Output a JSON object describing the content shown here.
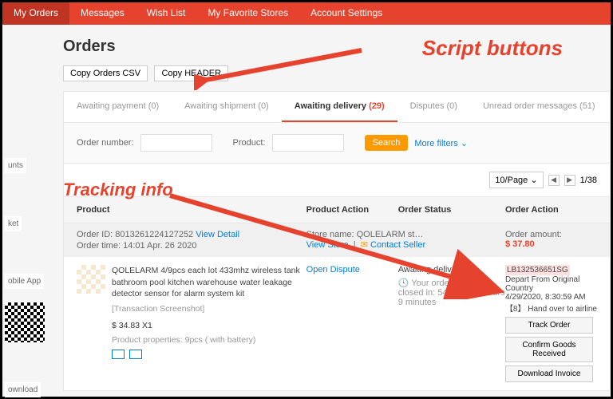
{
  "nav": {
    "items": [
      "My Orders",
      "Messages",
      "Wish List",
      "My Favorite Stores",
      "Account Settings"
    ],
    "active": 0
  },
  "page": {
    "title": "Orders"
  },
  "script_buttons": [
    "Copy Orders CSV",
    "Copy HEADER"
  ],
  "tabs": [
    {
      "label": "Awaiting payment",
      "count": "(0)"
    },
    {
      "label": "Awaiting shipment",
      "count": "(0)"
    },
    {
      "label": "Awaiting delivery",
      "count": "(29)",
      "active": true
    },
    {
      "label": "Disputes",
      "count": "(0)"
    },
    {
      "label": "Unread order messages",
      "count": "(51)"
    }
  ],
  "filters": {
    "order_label": "Order number:",
    "product_label": "Product:",
    "search": "Search",
    "more": "More filters"
  },
  "pager": {
    "per_page": "10/Page",
    "position": "1/38"
  },
  "columns": [
    "Product",
    "Product Action",
    "Order Status",
    "Order Action"
  ],
  "order": {
    "id_label": "Order ID:",
    "id": "8013261224127252",
    "view_detail": "View Detail",
    "time_label": "Order time:",
    "time": "14:01 Apr. 26 2020",
    "store_label": "Store name:",
    "store": "QOLELARM st…",
    "view_store": "View Store",
    "contact_seller": "Contact Seller",
    "amount_label": "Order amount:",
    "amount": "$ 37.80"
  },
  "item": {
    "title": "QOLELARM 4/9pcs each lot 433mhz wireless tank bathroom pool kitchen warehouse water leakage detector sensor for alarm system kit",
    "screenshot": "[Transaction Screenshot]",
    "price": "$ 34.83 X1",
    "props": "Product properties: 9pcs ( with battery)",
    "open_dispute": "Open Dispute",
    "status": "Awaiting delivery",
    "close_msg": "Your order will be closed in: 54 days 14 hours 9 minutes"
  },
  "tracking": {
    "number": "LB132536651SG",
    "status": "Depart From Original Country",
    "time": "4/29/2020, 8:30:59 AM",
    "detail": "【8】 Hand over to airline",
    "btn_track": "Track Order",
    "btn_confirm": "Confirm Goods Received",
    "btn_invoice": "Download Invoice"
  },
  "sidebar": {
    "unts": "unts",
    "ket": "ket",
    "app": "obile App",
    "download": "ownload"
  },
  "annotations": {
    "script": "Script buttons",
    "tracking": "Tracking info"
  }
}
